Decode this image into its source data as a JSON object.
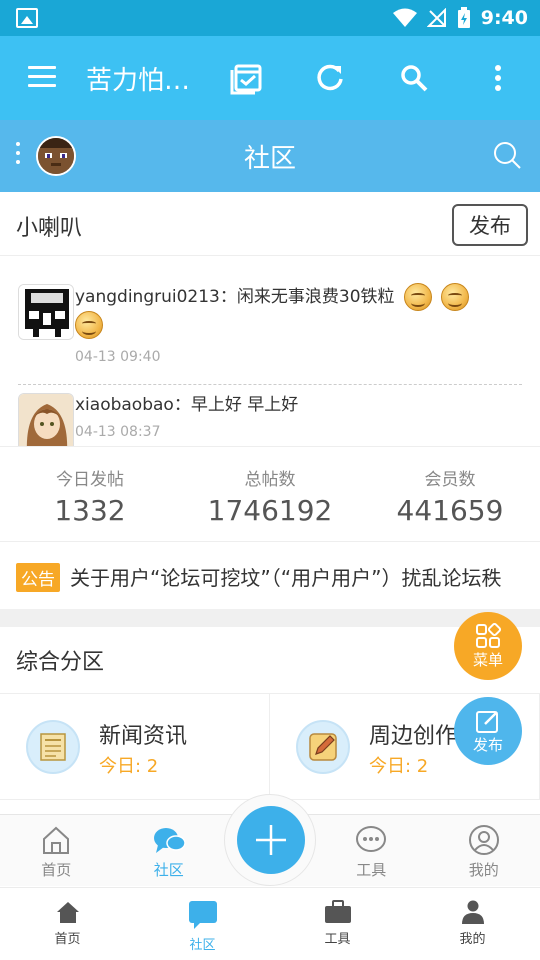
{
  "status_bar": {
    "time": "9:40"
  },
  "app_bar": {
    "title": "苦力怕…"
  },
  "community_header": {
    "title": "社区"
  },
  "speaker": {
    "title": "小喇叭",
    "publish_label": "发布",
    "posts": [
      {
        "user": "yangdingrui0213",
        "sep": "：",
        "message": "闲来无事浪费30铁粒",
        "time": "04-13 09:40"
      },
      {
        "user": "xiaobaobao",
        "sep": "：",
        "message": "早上好 早上好",
        "time": "04-13 08:37"
      }
    ]
  },
  "stats": [
    {
      "label": "今日发帖",
      "value": "1332"
    },
    {
      "label": "总帖数",
      "value": "1746192"
    },
    {
      "label": "会员数",
      "value": "441659"
    }
  ],
  "notice": {
    "tag": "公告",
    "text": "关于用户“论坛可挖坟”（“用户用户”）扰乱论坛秩"
  },
  "section": {
    "title": "综合分区",
    "forums": [
      {
        "name": "新闻资讯",
        "today": "今日: 2",
        "icon": "newspaper-icon"
      },
      {
        "name": "周边创作",
        "today": "今日: 2",
        "icon": "pencil-icon"
      }
    ]
  },
  "fab": {
    "menu_label": "菜单",
    "publish_label": "发布"
  },
  "inner_tabs": [
    {
      "label": "首页",
      "icon": "home-icon"
    },
    {
      "label": "社区",
      "icon": "chat-icon"
    },
    {
      "label": "工具",
      "icon": "chat-dots-icon"
    },
    {
      "label": "我的",
      "icon": "user-icon"
    }
  ],
  "bottom_nav": [
    {
      "label": "首页",
      "icon": "home-icon"
    },
    {
      "label": "社区",
      "icon": "chat-icon"
    },
    {
      "label": "工具",
      "icon": "briefcase-icon"
    },
    {
      "label": "我的",
      "icon": "person-icon"
    }
  ],
  "colors": {
    "primary": "#3dc1f3",
    "header": "#56b8ec",
    "accent": "#f7a826",
    "status_bar": "#1aa7d6"
  }
}
